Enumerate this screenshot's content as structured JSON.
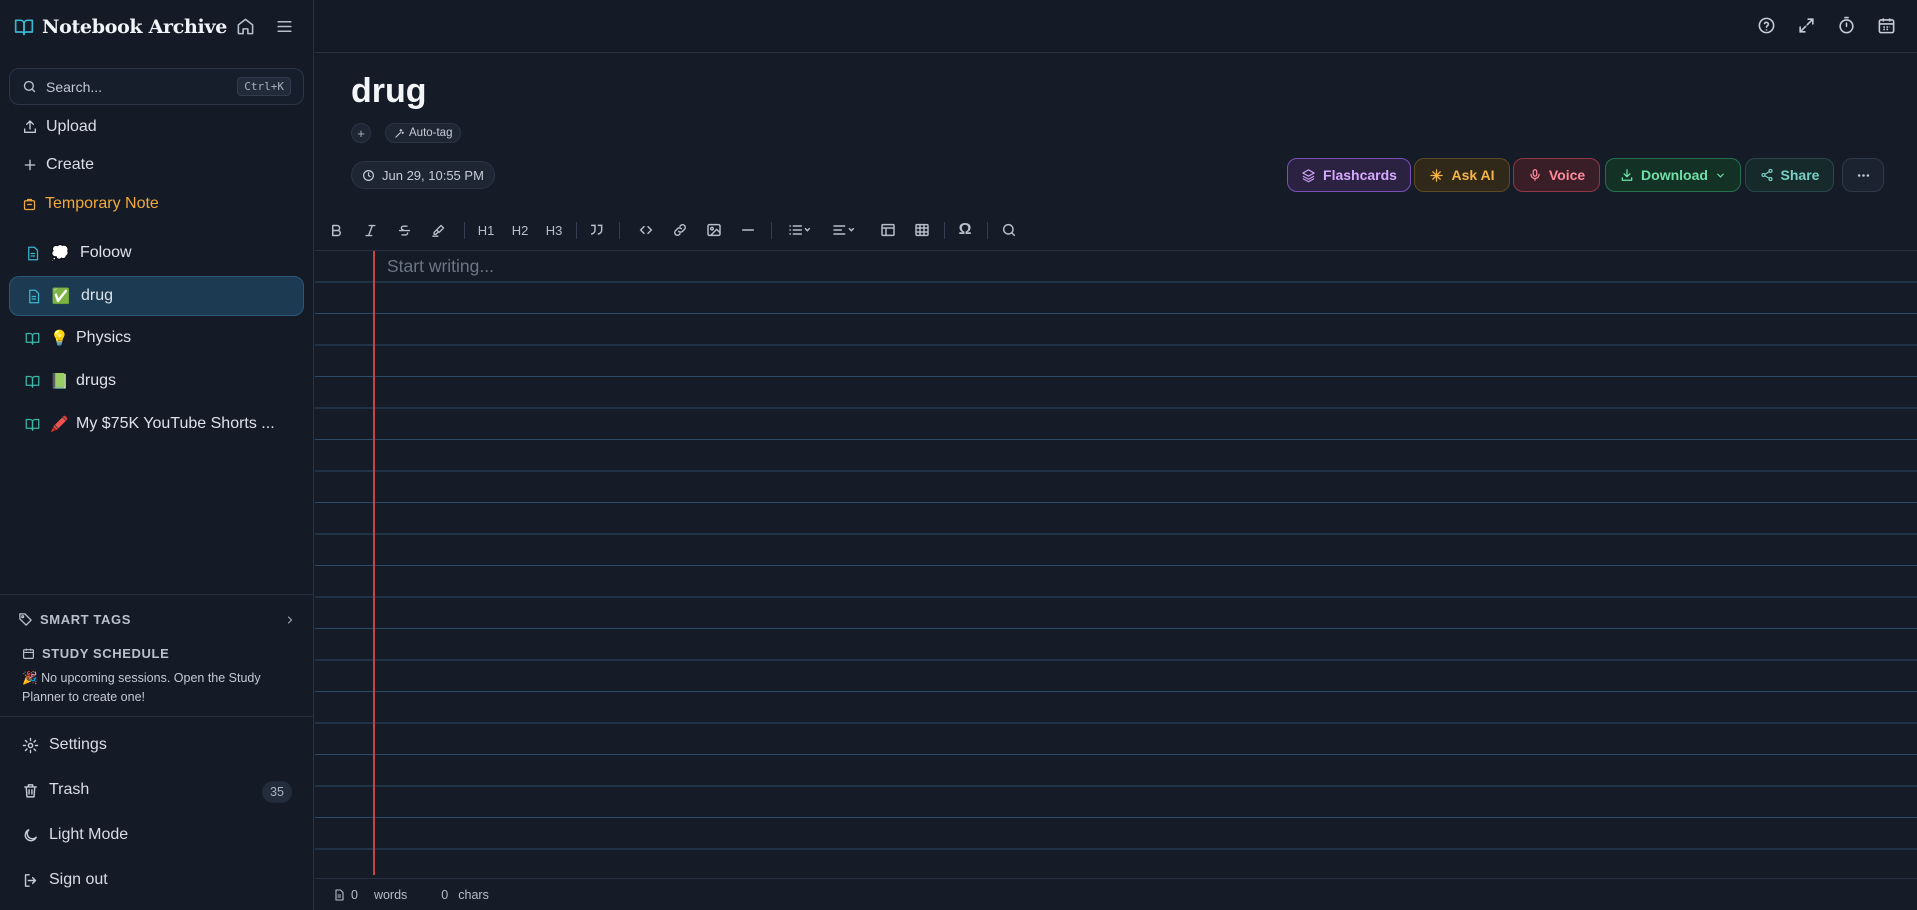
{
  "sidebar": {
    "brand_title": "Notebook Archive",
    "search": {
      "placeholder": "Search...",
      "shortcut": "Ctrl+K"
    },
    "nav": {
      "upload": "Upload",
      "create": "Create",
      "temporary_note": "Temporary Note"
    },
    "notes": [
      {
        "label": "Foloow",
        "emoji": "💭",
        "icon": "file-icon",
        "active": false
      },
      {
        "label": "drug",
        "emoji": "✅",
        "icon": "file-icon",
        "active": true
      },
      {
        "label": "Physics",
        "emoji": "💡",
        "icon": "book-icon",
        "active": false
      },
      {
        "label": "drugs",
        "emoji": "📗",
        "icon": "book-icon",
        "active": false
      },
      {
        "label": "My $75K YouTube Shorts ...",
        "emoji": "🖍️",
        "icon": "book-icon",
        "active": false
      }
    ],
    "smart_tags": "SMART TAGS",
    "study_schedule": {
      "title": "STUDY SCHEDULE",
      "emoji": "🎉",
      "message": "No upcoming sessions. Open the Study Planner to create one!"
    },
    "bottom": {
      "settings": "Settings",
      "trash": "Trash",
      "trash_count": "35",
      "light_mode": "Light Mode",
      "sign_out": "Sign out"
    }
  },
  "document": {
    "title": "drug",
    "tag_add": "+",
    "auto_tag": "Auto-tag",
    "date": "Jun 29, 10:55 PM",
    "placeholder": "Start writing..."
  },
  "actions": {
    "flashcards": "Flashcards",
    "ask_ai": "Ask AI",
    "voice": "Voice",
    "download": "Download",
    "share": "Share"
  },
  "toolbar": {
    "h1": "H1",
    "h2": "H2",
    "h3": "H3",
    "special_char": "Ω"
  },
  "status": {
    "words_count": "0",
    "words_label": "words",
    "chars_count": "0",
    "chars_label": "chars"
  },
  "colors": {
    "accent_blue": "#1c3a52",
    "temporary_note": "#f2a93b",
    "margin_red": "#c9453f"
  }
}
